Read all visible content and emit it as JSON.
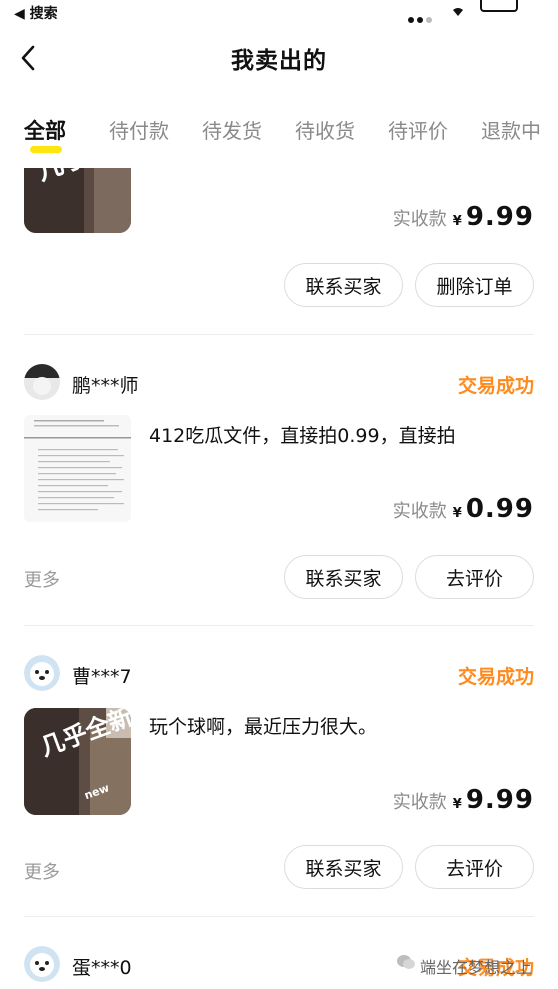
{
  "status_bar": {
    "back_label": "◀ 搜索"
  },
  "header": {
    "title": "我卖出的"
  },
  "tabs": [
    "全部",
    "待付款",
    "待发货",
    "待收货",
    "待评价",
    "退款中"
  ],
  "orders": [
    {
      "seller": "",
      "status": "",
      "title": "",
      "price_label": "实收款",
      "currency": "¥",
      "price": "9.99",
      "more_label": "",
      "buttons": [
        "联系买家",
        "删除订单"
      ]
    },
    {
      "seller": "鹏***师",
      "status": "交易成功",
      "title": "412吃瓜文件，直接拍0.99，直接拍",
      "price_label": "实收款",
      "currency": "¥",
      "price": "0.99",
      "more_label": "更多",
      "buttons": [
        "联系买家",
        "去评价"
      ]
    },
    {
      "seller": "曹***7",
      "status": "交易成功",
      "title": "玩个球啊，最近压力很大。",
      "price_label": "实收款",
      "currency": "¥",
      "price": "9.99",
      "more_label": "更多",
      "buttons": [
        "联系买家",
        "去评价"
      ]
    },
    {
      "seller": "蛋***0",
      "status": "交易成功",
      "title": "",
      "price_label": "",
      "currency": "",
      "price": "",
      "more_label": "",
      "buttons": []
    }
  ],
  "thumbnail": {
    "overlay_text": "几乎全新",
    "badge": "new"
  },
  "watermark": "端坐在梦想之上",
  "colors": {
    "accent_yellow": "#ffe60f",
    "status_orange": "#ff8a1e"
  }
}
